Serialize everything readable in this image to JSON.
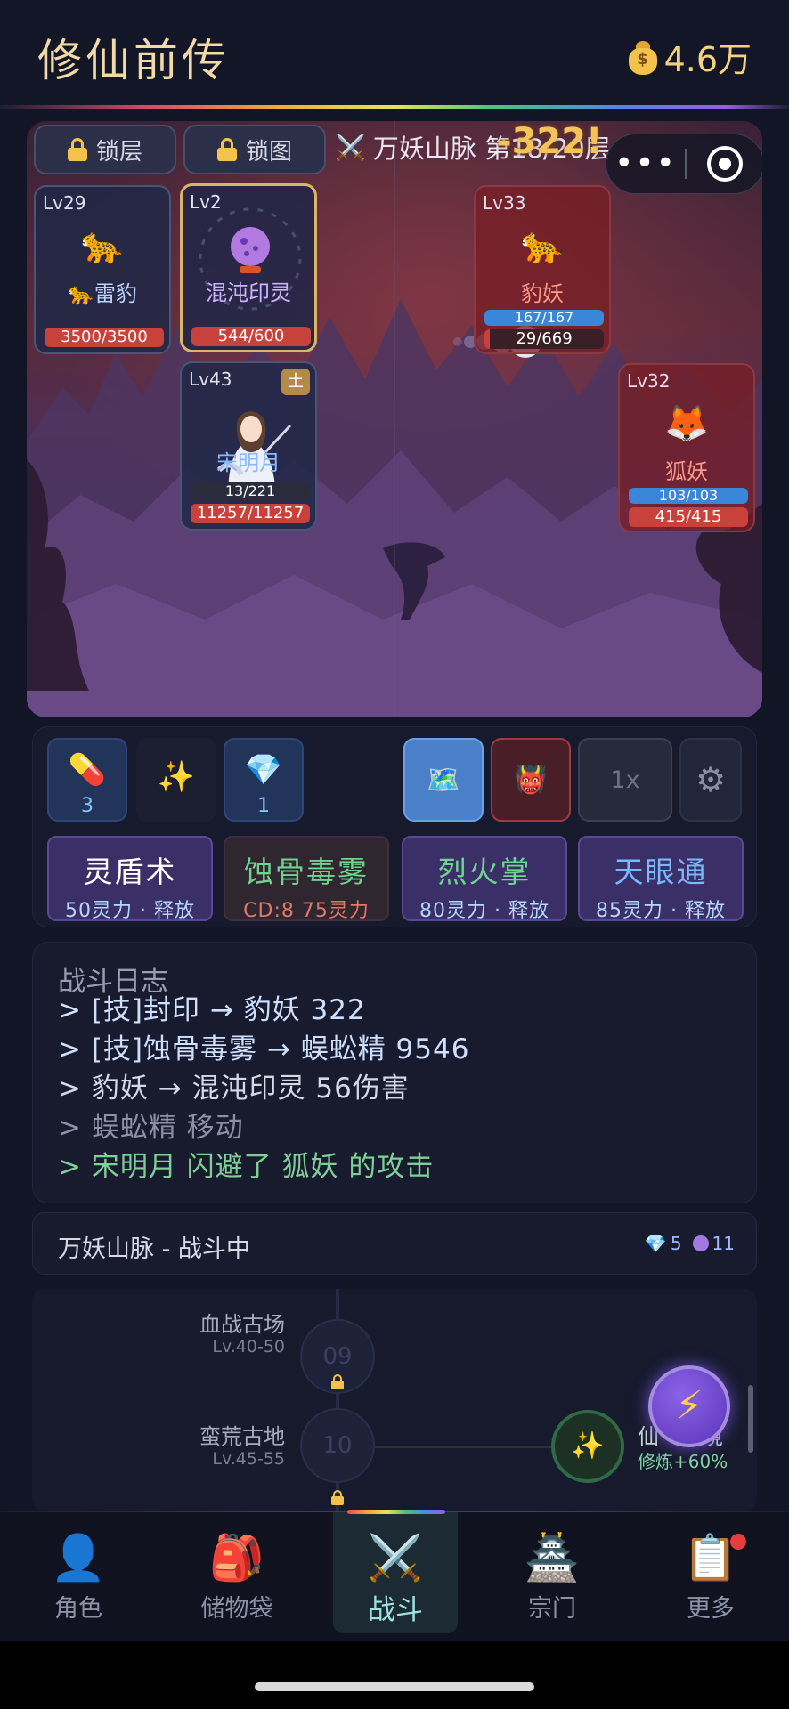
{
  "app": {
    "title": "修仙前传",
    "currency": "4.6万",
    "currency_icon": "money-bag-icon"
  },
  "battle": {
    "lock_floor_label": "锁层",
    "lock_map_label": "锁图",
    "location": "万妖山脉 第18/20层",
    "damage_float": "-322!",
    "units": [
      {
        "level": "Lv29",
        "icon": "🐆",
        "name": "🐆雷豹",
        "hp": "3500/3500",
        "side": "ally"
      },
      {
        "level": "Lv2",
        "name": "混沌印灵",
        "hp": "544/600",
        "side": "ally",
        "selected": true
      },
      {
        "level": "Lv43",
        "name": "宋明月",
        "element": "土",
        "mp": "13/221",
        "hp": "11257/11257",
        "side": "ally"
      },
      {
        "level": "Lv33",
        "icon": "🐆",
        "name": "豹妖",
        "mp": "167/167",
        "hp": "29/669",
        "side": "enemy"
      },
      {
        "level": "Lv32",
        "icon": "🦊",
        "name": "狐妖",
        "mp": "103/103",
        "hp": "415/415",
        "side": "enemy"
      }
    ]
  },
  "actions": {
    "items": [
      {
        "icon": "💊",
        "count": "3"
      },
      {
        "icon": "✨",
        "count": ""
      },
      {
        "icon": "💎",
        "count": "1"
      }
    ],
    "map_icon": "🗺️",
    "demon_icon": "👹",
    "speed": "1x",
    "settings_icon": "⚙",
    "skills": [
      {
        "name": "灵盾术",
        "info": "50灵力 · 释放"
      },
      {
        "name": "蚀骨毒雾",
        "info": "CD:8  75灵力"
      },
      {
        "name": "烈火掌",
        "info": "80灵力 · 释放"
      },
      {
        "name": "天眼通",
        "info": "85灵力 · 释放"
      }
    ]
  },
  "log": {
    "title": "战斗日志",
    "lines": [
      "> [技]封印 → 豹妖 322",
      "> [技]蚀骨毒雾 → 蜈蚣精 9546",
      "> 豹妖 → 混沌印灵 56伤害",
      "> 蜈蚣精 移动",
      "> 宋明月 闪避了 狐妖 的攻击"
    ]
  },
  "status": {
    "text": "万妖山脉 - 战斗中",
    "gems": "5",
    "orbs": "11"
  },
  "map": {
    "nodes": [
      {
        "number": "09",
        "name": "血战古场",
        "level": "Lv.40-50"
      },
      {
        "number": "10",
        "name": "蛮荒古地",
        "level": "Lv.45-55"
      }
    ],
    "side_node": {
      "name": "仙",
      "suffix": "境",
      "bonus": "修炼+60%"
    },
    "fab_icon": "⚡"
  },
  "nav": {
    "items": [
      {
        "label": "角色",
        "icon": "👤"
      },
      {
        "label": "储物袋",
        "icon": "🎒"
      },
      {
        "label": "战斗",
        "icon": "⚔️"
      },
      {
        "label": "宗门",
        "icon": "🏯"
      },
      {
        "label": "更多",
        "icon": "📋"
      }
    ]
  },
  "colors": {
    "accent_gold": "#f1d9a8",
    "hp_red": "#c8413a",
    "mp_blue": "#3a86d8",
    "active_tab": "#9ee3e0"
  }
}
